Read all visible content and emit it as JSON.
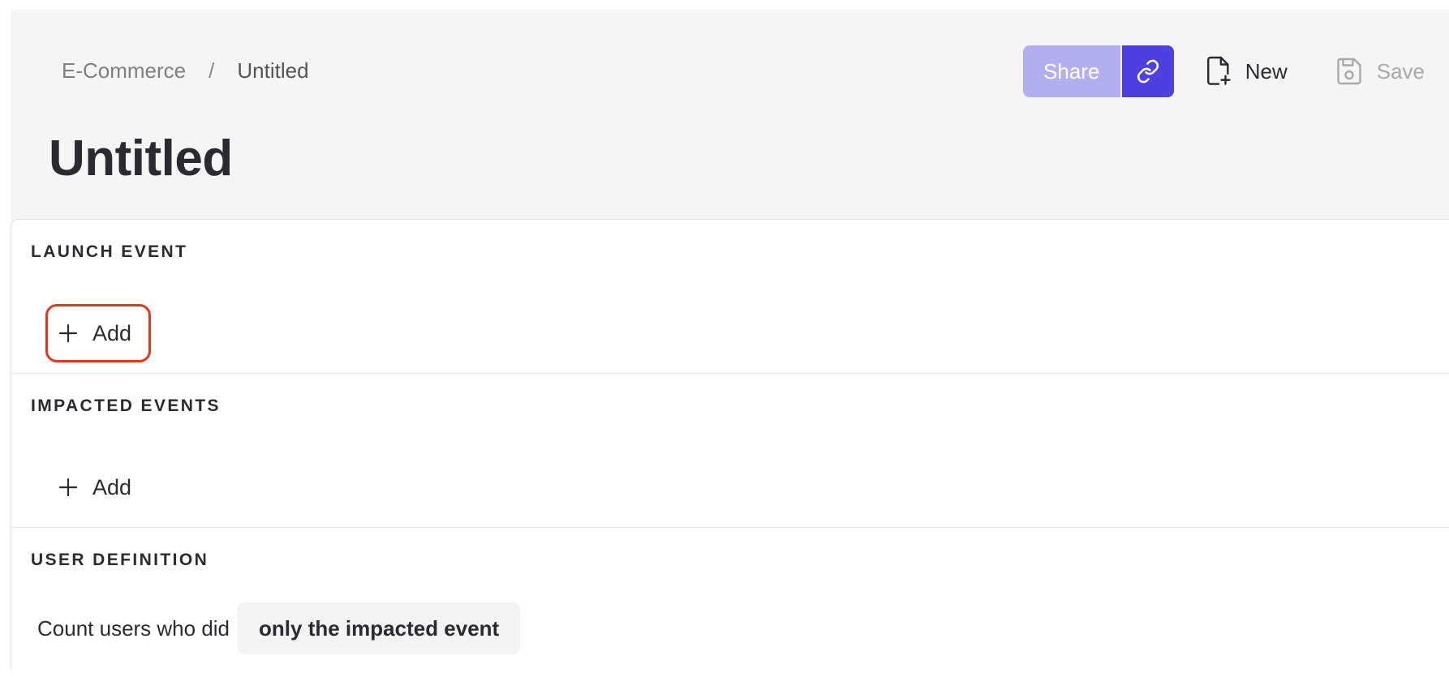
{
  "breadcrumb": {
    "parent": "E-Commerce",
    "separator": "/",
    "current": "Untitled"
  },
  "page": {
    "title": "Untitled"
  },
  "toolbar": {
    "share_label": "Share",
    "link_icon": "link-icon",
    "new_label": "New",
    "new_icon": "file-plus-icon",
    "save_label": "Save",
    "save_icon": "save-icon",
    "share_color": "#b3aef0",
    "accent_color": "#4e3fe0"
  },
  "sections": {
    "launch_event": {
      "title": "LAUNCH EVENT",
      "add_label": "Add"
    },
    "impacted_events": {
      "title": "IMPACTED EVENTS",
      "add_label": "Add"
    },
    "user_definition": {
      "title": "USER DEFINITION",
      "prefix": "Count users who did",
      "selected_option": "only the impacted event"
    }
  },
  "highlight_color": "#e8341c"
}
